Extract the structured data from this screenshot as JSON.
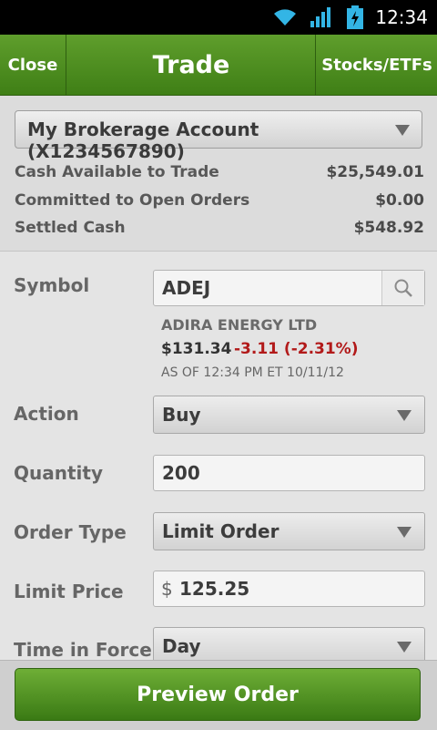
{
  "status_bar": {
    "time": "12:34",
    "icons": [
      "wifi-icon",
      "signal-icon",
      "battery-charging-icon"
    ]
  },
  "action_bar": {
    "close_label": "Close",
    "title": "Trade",
    "stocks_label": "Stocks/ETFs"
  },
  "account": {
    "selected": "My Brokerage Account (X1234567890)",
    "rows": [
      {
        "label": "Cash Available to Trade",
        "value": "$25,549.01"
      },
      {
        "label": "Committed to Open Orders",
        "value": "$0.00"
      },
      {
        "label": "Settled Cash",
        "value": "$548.92"
      }
    ]
  },
  "form": {
    "symbol": {
      "label": "Symbol",
      "value": "ADEJ"
    },
    "quote": {
      "name": "ADIRA ENERGY LTD",
      "price": "$131.34",
      "change": "-3.11 (-2.31%)",
      "as_of": "AS OF 12:34 PM ET 10/11/12"
    },
    "action": {
      "label": "Action",
      "value": "Buy"
    },
    "quantity": {
      "label": "Quantity",
      "value": "200"
    },
    "order_type": {
      "label": "Order Type",
      "value": "Limit Order"
    },
    "limit_price": {
      "label": "Limit Price",
      "currency": "$",
      "value": "125.25"
    },
    "time_in_force": {
      "label": "Time in Force",
      "value": "Day"
    }
  },
  "footer": {
    "preview_label": "Preview Order"
  },
  "colors": {
    "brand_green": "#4a8a1e",
    "negative": "#b21a1a"
  }
}
